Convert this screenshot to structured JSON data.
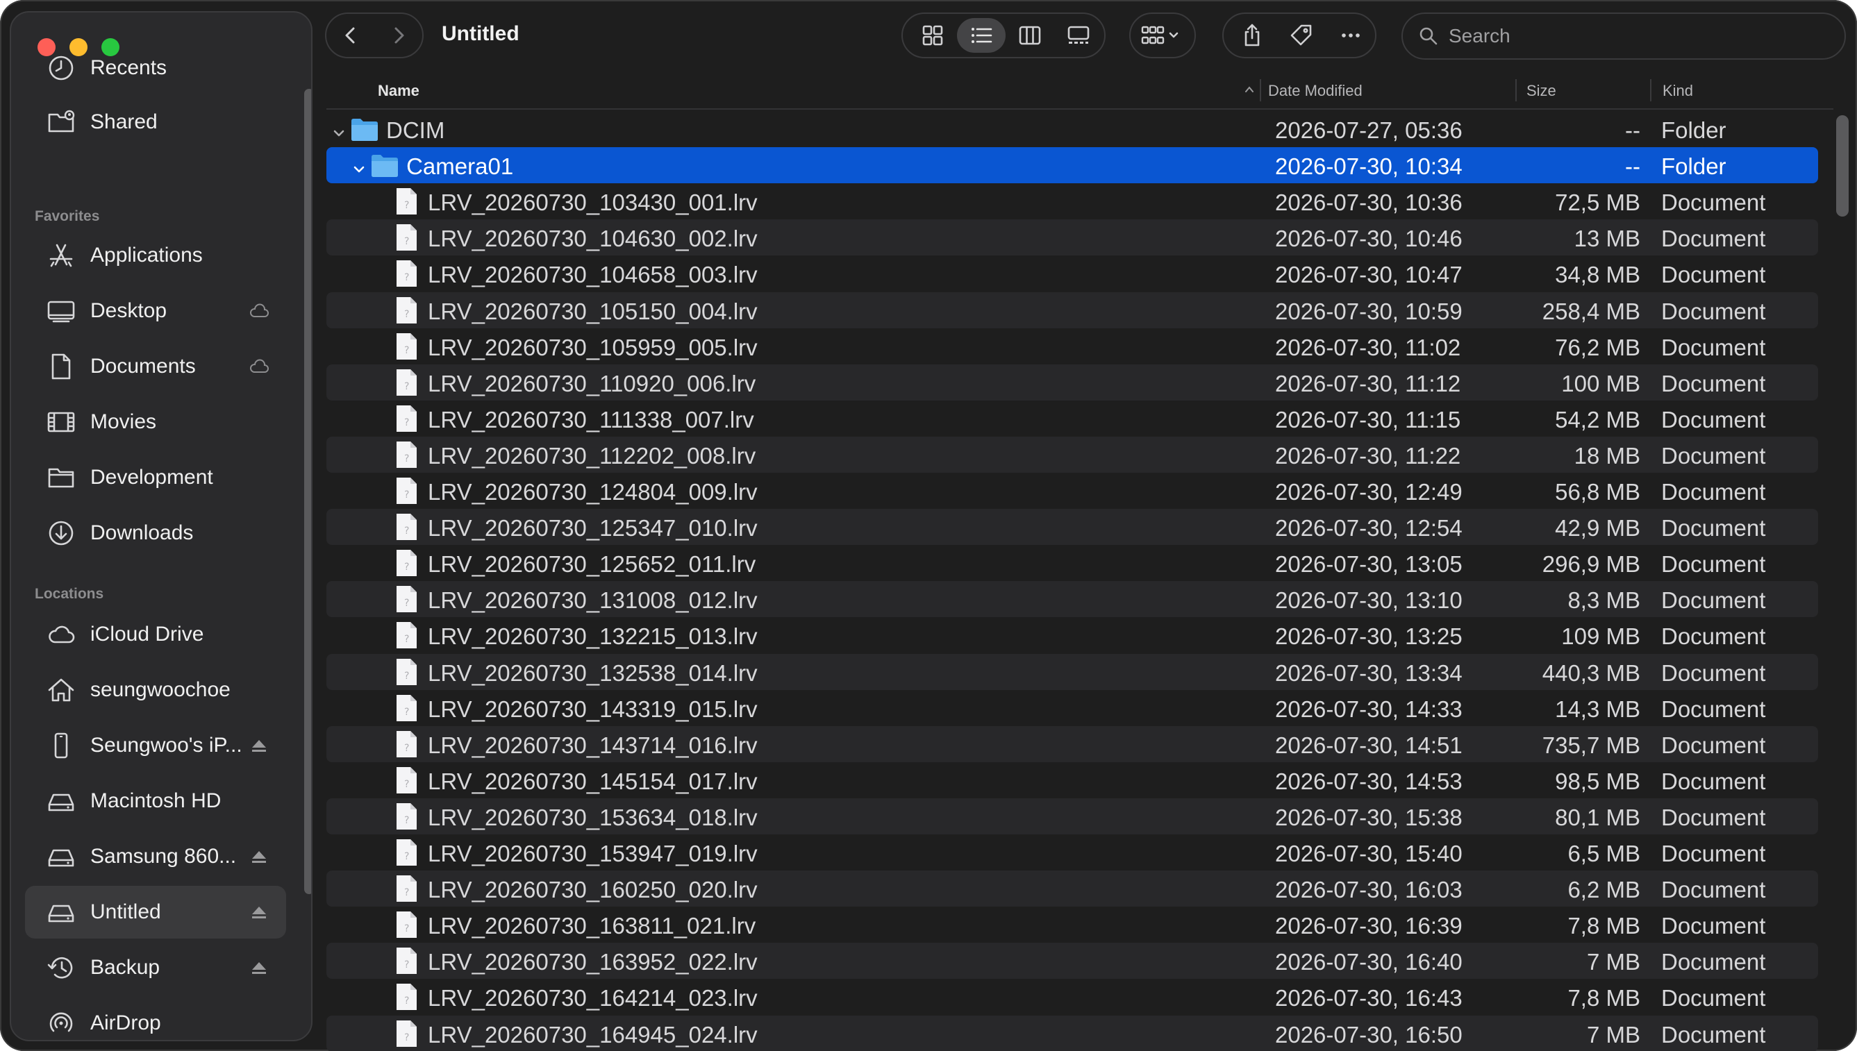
{
  "window": {
    "title": "Untitled"
  },
  "sidebar": {
    "top_items": [
      {
        "label": "Recents",
        "icon": "clock-icon"
      },
      {
        "label": "Shared",
        "icon": "shared-folder-icon"
      }
    ],
    "favorites_title": "Favorites",
    "favorites": [
      {
        "label": "Applications",
        "icon": "applications-icon",
        "cloud": false
      },
      {
        "label": "Desktop",
        "icon": "desktop-icon",
        "cloud": true
      },
      {
        "label": "Documents",
        "icon": "document-icon",
        "cloud": true
      },
      {
        "label": "Movies",
        "icon": "film-icon",
        "cloud": false
      },
      {
        "label": "Development",
        "icon": "folder-icon",
        "cloud": false
      },
      {
        "label": "Downloads",
        "icon": "download-icon",
        "cloud": false
      }
    ],
    "locations_title": "Locations",
    "locations": [
      {
        "label": "iCloud Drive",
        "icon": "cloud-icon",
        "eject": false
      },
      {
        "label": "seungwoochoe",
        "icon": "home-icon",
        "eject": false
      },
      {
        "label": "Seungwoo's iP...",
        "icon": "iphone-icon",
        "eject": true
      },
      {
        "label": "Macintosh HD",
        "icon": "drive-icon",
        "eject": false
      },
      {
        "label": "Samsung 860...",
        "icon": "drive-icon",
        "eject": true
      },
      {
        "label": "Untitled",
        "icon": "drive-icon",
        "eject": true,
        "selected": true
      },
      {
        "label": "Backup",
        "icon": "time-machine-icon",
        "eject": true
      },
      {
        "label": "AirDrop",
        "icon": "airdrop-icon",
        "eject": false
      }
    ]
  },
  "search": {
    "placeholder": "Search"
  },
  "columns": {
    "name": "Name",
    "date": "Date Modified",
    "size": "Size",
    "kind": "Kind"
  },
  "rows": [
    {
      "name": "DCIM",
      "date": "2026-07-27, 05:36",
      "size": "--",
      "kind": "Folder",
      "type": "folder",
      "level": 0,
      "expanded": true
    },
    {
      "name": "Camera01",
      "date": "2026-07-30, 10:34",
      "size": "--",
      "kind": "Folder",
      "type": "folder",
      "level": 1,
      "expanded": true,
      "selected": true
    },
    {
      "name": "LRV_20260730_103430_001.lrv",
      "date": "2026-07-30, 10:36",
      "size": "72,5 MB",
      "kind": "Document",
      "type": "file",
      "level": 2
    },
    {
      "name": "LRV_20260730_104630_002.lrv",
      "date": "2026-07-30, 10:46",
      "size": "13 MB",
      "kind": "Document",
      "type": "file",
      "level": 2
    },
    {
      "name": "LRV_20260730_104658_003.lrv",
      "date": "2026-07-30, 10:47",
      "size": "34,8 MB",
      "kind": "Document",
      "type": "file",
      "level": 2
    },
    {
      "name": "LRV_20260730_105150_004.lrv",
      "date": "2026-07-30, 10:59",
      "size": "258,4 MB",
      "kind": "Document",
      "type": "file",
      "level": 2
    },
    {
      "name": "LRV_20260730_105959_005.lrv",
      "date": "2026-07-30, 11:02",
      "size": "76,2 MB",
      "kind": "Document",
      "type": "file",
      "level": 2
    },
    {
      "name": "LRV_20260730_110920_006.lrv",
      "date": "2026-07-30, 11:12",
      "size": "100 MB",
      "kind": "Document",
      "type": "file",
      "level": 2
    },
    {
      "name": "LRV_20260730_111338_007.lrv",
      "date": "2026-07-30, 11:15",
      "size": "54,2 MB",
      "kind": "Document",
      "type": "file",
      "level": 2
    },
    {
      "name": "LRV_20260730_112202_008.lrv",
      "date": "2026-07-30, 11:22",
      "size": "18 MB",
      "kind": "Document",
      "type": "file",
      "level": 2
    },
    {
      "name": "LRV_20260730_124804_009.lrv",
      "date": "2026-07-30, 12:49",
      "size": "56,8 MB",
      "kind": "Document",
      "type": "file",
      "level": 2
    },
    {
      "name": "LRV_20260730_125347_010.lrv",
      "date": "2026-07-30, 12:54",
      "size": "42,9 MB",
      "kind": "Document",
      "type": "file",
      "level": 2
    },
    {
      "name": "LRV_20260730_125652_011.lrv",
      "date": "2026-07-30, 13:05",
      "size": "296,9 MB",
      "kind": "Document",
      "type": "file",
      "level": 2
    },
    {
      "name": "LRV_20260730_131008_012.lrv",
      "date": "2026-07-30, 13:10",
      "size": "8,3 MB",
      "kind": "Document",
      "type": "file",
      "level": 2
    },
    {
      "name": "LRV_20260730_132215_013.lrv",
      "date": "2026-07-30, 13:25",
      "size": "109 MB",
      "kind": "Document",
      "type": "file",
      "level": 2
    },
    {
      "name": "LRV_20260730_132538_014.lrv",
      "date": "2026-07-30, 13:34",
      "size": "440,3 MB",
      "kind": "Document",
      "type": "file",
      "level": 2
    },
    {
      "name": "LRV_20260730_143319_015.lrv",
      "date": "2026-07-30, 14:33",
      "size": "14,3 MB",
      "kind": "Document",
      "type": "file",
      "level": 2
    },
    {
      "name": "LRV_20260730_143714_016.lrv",
      "date": "2026-07-30, 14:51",
      "size": "735,7 MB",
      "kind": "Document",
      "type": "file",
      "level": 2
    },
    {
      "name": "LRV_20260730_145154_017.lrv",
      "date": "2026-07-30, 14:53",
      "size": "98,5 MB",
      "kind": "Document",
      "type": "file",
      "level": 2
    },
    {
      "name": "LRV_20260730_153634_018.lrv",
      "date": "2026-07-30, 15:38",
      "size": "80,1 MB",
      "kind": "Document",
      "type": "file",
      "level": 2
    },
    {
      "name": "LRV_20260730_153947_019.lrv",
      "date": "2026-07-30, 15:40",
      "size": "6,5 MB",
      "kind": "Document",
      "type": "file",
      "level": 2
    },
    {
      "name": "LRV_20260730_160250_020.lrv",
      "date": "2026-07-30, 16:03",
      "size": "6,2 MB",
      "kind": "Document",
      "type": "file",
      "level": 2
    },
    {
      "name": "LRV_20260730_163811_021.lrv",
      "date": "2026-07-30, 16:39",
      "size": "7,8 MB",
      "kind": "Document",
      "type": "file",
      "level": 2
    },
    {
      "name": "LRV_20260730_163952_022.lrv",
      "date": "2026-07-30, 16:40",
      "size": "7 MB",
      "kind": "Document",
      "type": "file",
      "level": 2
    },
    {
      "name": "LRV_20260730_164214_023.lrv",
      "date": "2026-07-30, 16:43",
      "size": "7,8 MB",
      "kind": "Document",
      "type": "file",
      "level": 2
    },
    {
      "name": "LRV_20260730_164945_024.lrv",
      "date": "2026-07-30, 16:50",
      "size": "7 MB",
      "kind": "Document",
      "type": "file",
      "level": 2
    }
  ],
  "colors": {
    "accent": "#0a56d2",
    "background": "#1e1e1e",
    "sidebar": "#2a2a2c",
    "folder": "#5aaef0"
  }
}
